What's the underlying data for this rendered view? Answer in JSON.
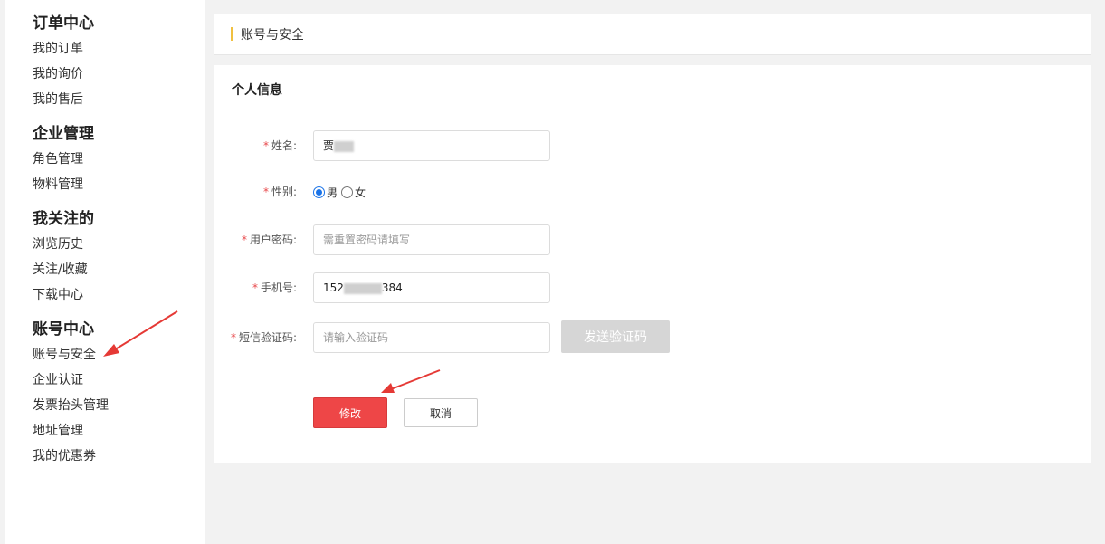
{
  "sidebar": {
    "groups": [
      {
        "title": "订单中心",
        "items": [
          "我的订单",
          "我的询价",
          "我的售后"
        ]
      },
      {
        "title": "企业管理",
        "items": [
          "角色管理",
          "物料管理"
        ]
      },
      {
        "title": "我关注的",
        "items": [
          "浏览历史",
          "关注/收藏",
          "下载中心"
        ]
      },
      {
        "title": "账号中心",
        "items": [
          "账号与安全",
          "企业认证",
          "发票抬头管理",
          "地址管理",
          "我的优惠券"
        ]
      }
    ]
  },
  "header": {
    "title": "账号与安全"
  },
  "form": {
    "section_title": "个人信息",
    "required_mark": "*",
    "name": {
      "label": "姓名:",
      "value_visible": "贾"
    },
    "gender": {
      "label": "性别:",
      "options": [
        "男",
        "女"
      ],
      "selected": "男"
    },
    "password": {
      "label": "用户密码:",
      "placeholder": "需重置密码请填写"
    },
    "phone": {
      "label": "手机号:",
      "value_prefix": "152",
      "value_suffix": "384"
    },
    "sms": {
      "label": "短信验证码:",
      "placeholder": "请输入验证码",
      "send_button": "发送验证码"
    },
    "submit_button": "修改",
    "cancel_button": "取消"
  },
  "colors": {
    "primary": "#ee4647",
    "accent": "#f0c040",
    "radio": "#1a73e8",
    "annotation_arrow": "#e53935"
  }
}
